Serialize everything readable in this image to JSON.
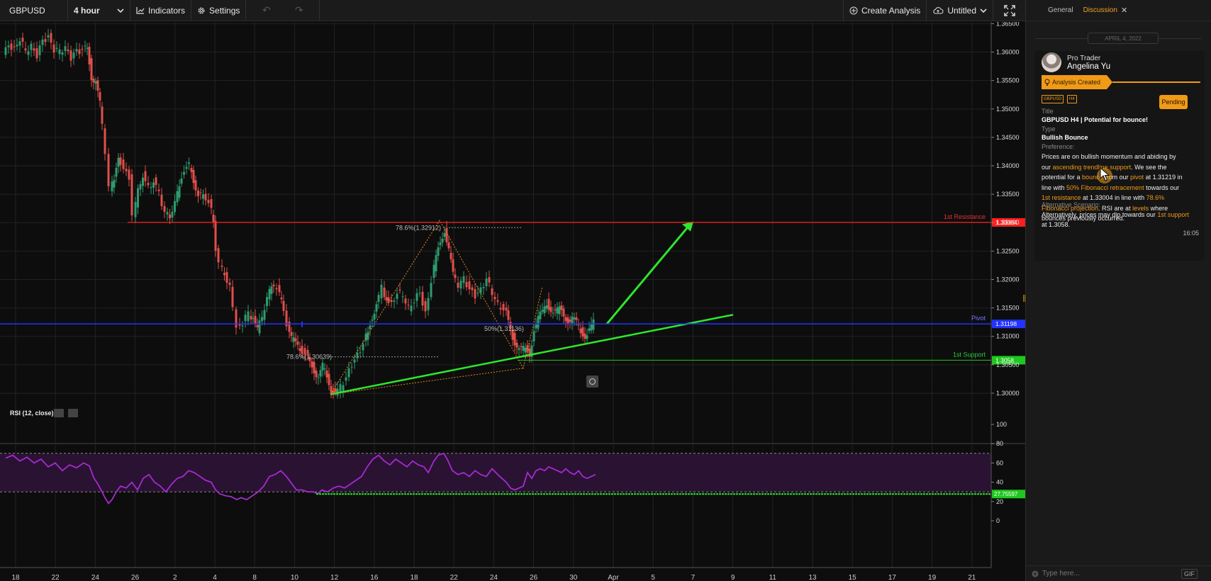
{
  "toolbar": {
    "symbol": "GBPUSD",
    "timeframe": "4 hour",
    "indicators_label": "Indicators",
    "settings_label": "Settings",
    "create_analysis_label": "Create Analysis",
    "layout_name": "Untitled"
  },
  "panel": {
    "tabs": [
      "General",
      "Discussion"
    ],
    "active_tab": "Discussion",
    "date_separator": "APRIL 4, 2022",
    "card": {
      "role": "Pro Trader",
      "author": "Angelina Yu",
      "status": "Analysis Created",
      "tags": [
        "GBPUSD",
        "H4"
      ],
      "state_button": "Pending",
      "title_label": "Title",
      "title": "GBPUSD H4 | Potential for bounce!",
      "type_label": "Type",
      "type": "Bullish Bounce",
      "preference_label": "Preference:",
      "desc": {
        "t1": "Prices are on bullish momentum and abiding by our ",
        "h1": "ascending trendline support",
        "t2": ". We see the potential for a ",
        "h2": "bounce",
        "t3": " from our ",
        "h3": "pivot",
        "t4": " at 1.31219 in line with ",
        "h4": "50% Fibonacci retracement",
        "t5": " towards our ",
        "h5": "1st resistance",
        "t6": " at 1.33004 in line with ",
        "h6": "78.6% Fibonacci projection",
        "t7": ". RSI are at ",
        "h7": "levels",
        "t8": " where bounces previously occurred."
      },
      "alt_label": "Alternative Scenario:",
      "alt": {
        "t1": "Alternatively, prices may dip towards our ",
        "h1": "1st support",
        "t2": " at 1.3058."
      },
      "time": "16:05"
    },
    "composer_placeholder": "Type here...",
    "gif_label": "GIF"
  },
  "chart_data": {
    "type": "candlestick",
    "symbol": "GBPUSD",
    "price_axis": {
      "range": [
        1.2975,
        1.3653
      ],
      "ticks": [
        "1.36500",
        "1.36000",
        "1.35500",
        "1.35000",
        "1.34500",
        "1.34000",
        "1.33500",
        "1.33000",
        "1.32500",
        "1.32000",
        "1.31500",
        "1.31000",
        "1.30500",
        "1.30000"
      ]
    },
    "x_ticks": [
      "18",
      "22",
      "24",
      "26",
      "2",
      "4",
      "8",
      "10",
      "12",
      "16",
      "18",
      "22",
      "24",
      "26",
      "30",
      "Apr",
      "5",
      "7",
      "9",
      "11",
      "13",
      "15",
      "17",
      "19",
      "21"
    ],
    "close_path": [
      [
        0,
        1.3595
      ],
      [
        8,
        1.361
      ],
      [
        16,
        1.3605
      ],
      [
        24,
        1.3625
      ],
      [
        32,
        1.36
      ],
      [
        40,
        1.3612
      ],
      [
        48,
        1.3595
      ],
      [
        56,
        1.3618
      ],
      [
        64,
        1.3628
      ],
      [
        72,
        1.3605
      ],
      [
        80,
        1.36
      ],
      [
        88,
        1.361
      ],
      [
        96,
        1.359
      ],
      [
        104,
        1.36
      ],
      [
        112,
        1.3605
      ],
      [
        118,
        1.3612
      ],
      [
        124,
        1.3555
      ],
      [
        130,
        1.3545
      ],
      [
        136,
        1.351
      ],
      [
        140,
        1.347
      ],
      [
        145,
        1.3415
      ],
      [
        150,
        1.3358
      ],
      [
        156,
        1.3375
      ],
      [
        162,
        1.342
      ],
      [
        170,
        1.3395
      ],
      [
        178,
        1.338
      ],
      [
        183,
        1.331
      ],
      [
        190,
        1.3355
      ],
      [
        197,
        1.3385
      ],
      [
        205,
        1.336
      ],
      [
        212,
        1.3375
      ],
      [
        220,
        1.335
      ],
      [
        228,
        1.332
      ],
      [
        235,
        1.3312
      ],
      [
        242,
        1.3335
      ],
      [
        248,
        1.3365
      ],
      [
        255,
        1.3395
      ],
      [
        262,
        1.34
      ],
      [
        268,
        1.3375
      ],
      [
        275,
        1.335
      ],
      [
        282,
        1.3345
      ],
      [
        290,
        1.334
      ],
      [
        296,
        1.33
      ],
      [
        300,
        1.325
      ],
      [
        305,
        1.3225
      ],
      [
        312,
        1.321
      ],
      [
        320,
        1.319
      ],
      [
        325,
        1.315
      ],
      [
        330,
        1.3115
      ],
      [
        338,
        1.3125
      ],
      [
        346,
        1.314
      ],
      [
        352,
        1.313
      ],
      [
        358,
        1.311
      ],
      [
        365,
        1.3135
      ],
      [
        372,
        1.317
      ],
      [
        378,
        1.3185
      ],
      [
        386,
        1.3188
      ],
      [
        392,
        1.316
      ],
      [
        400,
        1.312
      ],
      [
        406,
        1.3095
      ],
      [
        412,
        1.309
      ],
      [
        418,
        1.308
      ],
      [
        426,
        1.307
      ],
      [
        432,
        1.306
      ],
      [
        438,
        1.304
      ],
      [
        444,
        1.3025
      ],
      [
        450,
        1.3048
      ],
      [
        456,
        1.303
      ],
      [
        462,
        1.3005
      ],
      [
        468,
        1.3
      ],
      [
        476,
        1.301
      ],
      [
        484,
        1.303
      ],
      [
        492,
        1.305
      ],
      [
        500,
        1.3065
      ],
      [
        508,
        1.309
      ],
      [
        514,
        1.311
      ],
      [
        520,
        1.3135
      ],
      [
        526,
        1.3155
      ],
      [
        534,
        1.3185
      ],
      [
        540,
        1.3165
      ],
      [
        548,
        1.3155
      ],
      [
        556,
        1.318
      ],
      [
        564,
        1.317
      ],
      [
        572,
        1.315
      ],
      [
        580,
        1.3165
      ],
      [
        588,
        1.3175
      ],
      [
        596,
        1.314
      ],
      [
        604,
        1.32
      ],
      [
        610,
        1.324
      ],
      [
        616,
        1.327
      ],
      [
        622,
        1.3285
      ],
      [
        628,
        1.325
      ],
      [
        634,
        1.321
      ],
      [
        642,
        1.319
      ],
      [
        650,
        1.32
      ],
      [
        658,
        1.3185
      ],
      [
        666,
        1.317
      ],
      [
        674,
        1.318
      ],
      [
        682,
        1.3205
      ],
      [
        690,
        1.3175
      ],
      [
        698,
        1.3155
      ],
      [
        706,
        1.315
      ],
      [
        712,
        1.313
      ],
      [
        718,
        1.31
      ],
      [
        724,
        1.308
      ],
      [
        730,
        1.3075
      ],
      [
        736,
        1.308
      ],
      [
        742,
        1.307
      ],
      [
        748,
        1.311
      ],
      [
        754,
        1.313
      ],
      [
        760,
        1.3145
      ],
      [
        766,
        1.316
      ],
      [
        772,
        1.3145
      ],
      [
        778,
        1.314
      ],
      [
        784,
        1.315
      ],
      [
        790,
        1.314
      ],
      [
        796,
        1.3125
      ],
      [
        802,
        1.313
      ],
      [
        808,
        1.3125
      ],
      [
        814,
        1.311
      ],
      [
        820,
        1.31
      ],
      [
        826,
        1.311
      ],
      [
        832,
        1.3125
      ]
    ],
    "levels": [
      {
        "name": "1st Resistance",
        "value": 1.33004,
        "label": "1.33004",
        "color": "#ff1e1e"
      },
      {
        "name": "Pivot",
        "value": 1.31219,
        "label": "1.31198",
        "color": "#2233ff"
      },
      {
        "name": "1st Support",
        "value": 1.3058,
        "label": "1.3058",
        "color": "#1ec81e"
      }
    ],
    "fib_labels": [
      {
        "text": "78.6%(1.32912)",
        "value": 1.32912
      },
      {
        "text": "78.6%(1.30639)",
        "value": 1.30639
      },
      {
        "text": "50%(1.31136)",
        "value": 1.31136
      }
    ],
    "rsi": {
      "label": "RSI (12, close)",
      "range": [
        0,
        100
      ],
      "ticks": [
        "100",
        "80",
        "60",
        "40",
        "20",
        "0"
      ],
      "bands": [
        70,
        30
      ],
      "current_label": "27.75597",
      "current": 27.76,
      "series": [
        [
          0,
          65
        ],
        [
          10,
          68
        ],
        [
          20,
          62
        ],
        [
          30,
          66
        ],
        [
          40,
          60
        ],
        [
          50,
          64
        ],
        [
          60,
          56
        ],
        [
          70,
          60
        ],
        [
          80,
          52
        ],
        [
          90,
          58
        ],
        [
          100,
          55
        ],
        [
          110,
          60
        ],
        [
          118,
          57
        ],
        [
          124,
          45
        ],
        [
          130,
          38
        ],
        [
          136,
          30
        ],
        [
          140,
          24
        ],
        [
          145,
          18
        ],
        [
          150,
          22
        ],
        [
          156,
          30
        ],
        [
          162,
          36
        ],
        [
          170,
          34
        ],
        [
          178,
          40
        ],
        [
          186,
          32
        ],
        [
          194,
          44
        ],
        [
          202,
          48
        ],
        [
          210,
          40
        ],
        [
          218,
          36
        ],
        [
          226,
          30
        ],
        [
          234,
          38
        ],
        [
          242,
          44
        ],
        [
          250,
          46
        ],
        [
          258,
          52
        ],
        [
          266,
          50
        ],
        [
          274,
          46
        ],
        [
          282,
          42
        ],
        [
          290,
          40
        ],
        [
          296,
          32
        ],
        [
          302,
          28
        ],
        [
          310,
          26
        ],
        [
          318,
          25
        ],
        [
          326,
          22
        ],
        [
          332,
          24
        ],
        [
          340,
          22
        ],
        [
          348,
          26
        ],
        [
          356,
          30
        ],
        [
          364,
          36
        ],
        [
          372,
          46
        ],
        [
          380,
          48
        ],
        [
          388,
          52
        ],
        [
          396,
          46
        ],
        [
          404,
          38
        ],
        [
          410,
          32
        ],
        [
          418,
          32
        ],
        [
          426,
          30
        ],
        [
          434,
          30
        ],
        [
          440,
          28
        ],
        [
          446,
          32
        ],
        [
          454,
          30
        ],
        [
          462,
          34
        ],
        [
          470,
          36
        ],
        [
          478,
          34
        ],
        [
          486,
          38
        ],
        [
          494,
          42
        ],
        [
          502,
          46
        ],
        [
          510,
          56
        ],
        [
          518,
          64
        ],
        [
          526,
          68
        ],
        [
          534,
          62
        ],
        [
          542,
          58
        ],
        [
          550,
          64
        ],
        [
          558,
          60
        ],
        [
          566,
          56
        ],
        [
          574,
          62
        ],
        [
          582,
          58
        ],
        [
          590,
          56
        ],
        [
          596,
          50
        ],
        [
          604,
          62
        ],
        [
          610,
          68
        ],
        [
          618,
          70
        ],
        [
          624,
          62
        ],
        [
          630,
          52
        ],
        [
          638,
          48
        ],
        [
          646,
          50
        ],
        [
          654,
          46
        ],
        [
          662,
          52
        ],
        [
          670,
          48
        ],
        [
          678,
          46
        ],
        [
          686,
          54
        ],
        [
          694,
          48
        ],
        [
          700,
          44
        ],
        [
          706,
          40
        ],
        [
          712,
          34
        ],
        [
          718,
          32
        ],
        [
          724,
          34
        ],
        [
          730,
          36
        ],
        [
          736,
          50
        ],
        [
          742,
          44
        ],
        [
          748,
          52
        ],
        [
          754,
          54
        ],
        [
          760,
          52
        ],
        [
          766,
          56
        ],
        [
          772,
          54
        ],
        [
          778,
          52
        ],
        [
          784,
          50
        ],
        [
          790,
          54
        ],
        [
          796,
          50
        ],
        [
          802,
          48
        ],
        [
          808,
          52
        ],
        [
          814,
          46
        ],
        [
          820,
          44
        ],
        [
          826,
          46
        ],
        [
          832,
          48
        ]
      ]
    }
  }
}
